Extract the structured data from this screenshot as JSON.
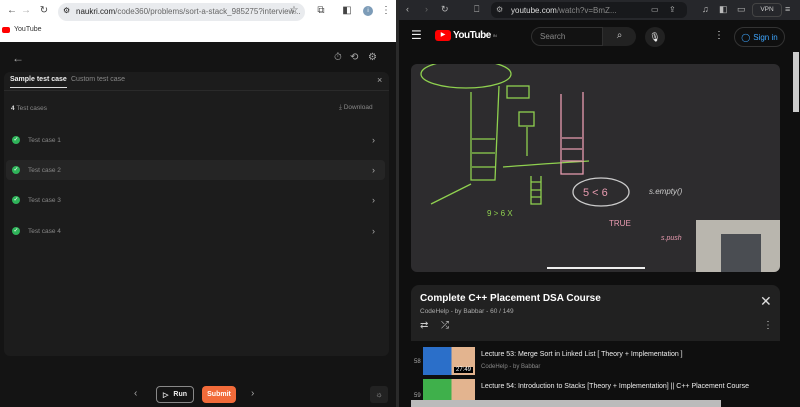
{
  "left_browser": {
    "url_host": "naukri.com",
    "url_path": "/code360/problems/sort-a-stack_985275?interview...",
    "bookmark": "YouTube",
    "avatar_initial": "i"
  },
  "app": {
    "tabs": [
      "Sample test case",
      "Custom test case"
    ],
    "test_count": "4",
    "test_count_label": "Test cases",
    "download": "Download",
    "test_cases": [
      "Test case 1",
      "Test case 2",
      "Test case 3",
      "Test case 4"
    ],
    "run": "Run",
    "submit": "Submit"
  },
  "right_browser": {
    "url_host": "youtube.com",
    "url_path": "/watch?v=BmZ...",
    "vpn": "VPN"
  },
  "youtube": {
    "logo": "YouTube",
    "region": "IN",
    "search_placeholder": "Search",
    "sign_in": "Sign in"
  },
  "video_sketch": {
    "notes": [
      "5 < 6",
      "TRUE",
      "s.empty()",
      "s.push",
      "9 > 6 X"
    ]
  },
  "playlist": {
    "title": "Complete C++ Placement DSA Course",
    "meta": "CodeHelp - by Babbar - 60 / 149",
    "items": [
      {
        "index": "58",
        "title": "Lecture 53: Merge Sort in Linked List [ Theory + Implementation ]",
        "channel": "CodeHelp - by Babbar",
        "duration": "27:49"
      },
      {
        "index": "59",
        "title": "Lecture 54: Introduction to Stacks [Theory + Implementation] || C++ Placement Course"
      }
    ]
  },
  "colors": {
    "accent_orange": "#f26b3a",
    "success_green": "#2fb45a",
    "youtube_red": "#ff0000",
    "link_blue": "#3ea6ff"
  }
}
